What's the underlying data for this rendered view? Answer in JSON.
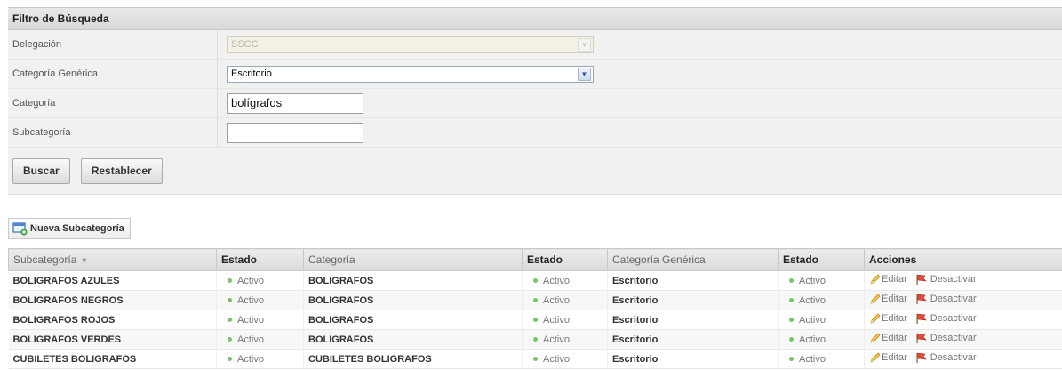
{
  "filter": {
    "title": "Filtro de Búsqueda",
    "delegacion_label": "Delegación",
    "delegacion_value": "SSCC",
    "cat_generica_label": "Categoría Genérica",
    "cat_generica_value": "Escritorio",
    "categoria_label": "Categoría",
    "categoria_value": "bolígrafos",
    "subcategoria_label": "Subcategoría",
    "subcategoria_value": "",
    "buscar_label": "Buscar",
    "restablecer_label": "Restablecer"
  },
  "new_button_label": "Nueva Subcategoría",
  "table": {
    "headers": [
      "Subcategoría",
      "Estado",
      "Categoría",
      "Estado",
      "Categoría Genérica",
      "Estado",
      "Acciones"
    ],
    "rows": [
      {
        "sub": "BOLIGRAFOS AZULES",
        "s1": "Activo",
        "cat": "BOLIGRAFOS",
        "s2": "Activo",
        "gen": "Escritorio",
        "s3": "Activo"
      },
      {
        "sub": "BOLIGRAFOS NEGROS",
        "s1": "Activo",
        "cat": "BOLIGRAFOS",
        "s2": "Activo",
        "gen": "Escritorio",
        "s3": "Activo"
      },
      {
        "sub": "BOLIGRAFOS ROJOS",
        "s1": "Activo",
        "cat": "BOLIGRAFOS",
        "s2": "Activo",
        "gen": "Escritorio",
        "s3": "Activo"
      },
      {
        "sub": "BOLIGRAFOS VERDES",
        "s1": "Activo",
        "cat": "BOLIGRAFOS",
        "s2": "Activo",
        "gen": "Escritorio",
        "s3": "Activo"
      },
      {
        "sub": "CUBILETES BOLIGRAFOS",
        "s1": "Activo",
        "cat": "CUBILETES BOLIGRAFOS",
        "s2": "Activo",
        "gen": "Escritorio",
        "s3": "Activo"
      }
    ],
    "edit_label": "Editar",
    "deactivate_label": "Desactivar"
  },
  "icons": {
    "dropdown": "chevron-down-icon",
    "new": "new-window-icon",
    "edit": "pencil-icon",
    "deactivate": "flag-icon",
    "status": "status-dot-icon",
    "sort": "sort-desc-icon"
  }
}
